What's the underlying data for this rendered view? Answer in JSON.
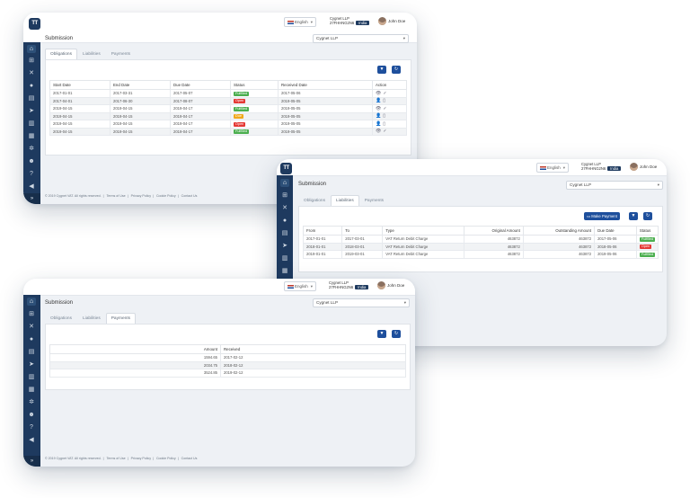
{
  "common": {
    "logo": "TT",
    "language": "English",
    "company_name": "Cygnet LLP",
    "company_vat": "27FHHNG2N6",
    "country_badge": "India",
    "user_name": "John Doe",
    "page_title": "Submission",
    "company_select": "Cygnet LLP",
    "tabs": [
      "Obligations",
      "Liabilities",
      "Payments"
    ],
    "footer": {
      "copyright": "© 2019 Cygnet VAT. All rights reserved.",
      "links": [
        "Terms of Use",
        "Privacy Policy",
        "Cookie Policy",
        "Contact Us"
      ]
    },
    "colors": {
      "sidebar": "#1e3a5f",
      "primary": "#1e4f9c",
      "fulfilled": "#4caf50",
      "open": "#e53935",
      "due": "#f0a81c"
    }
  },
  "obligations": {
    "columns": [
      "Start Date",
      "End Date",
      "Due Date",
      "Status",
      "Received Date",
      "Action"
    ],
    "rows": [
      {
        "start": "2017-01-01",
        "end": "2017-03-31",
        "due": "2017-05-07",
        "status": "Fulfilled",
        "received": "2017-05-06",
        "action": "view,check"
      },
      {
        "start": "2017-04-01",
        "end": "2017-06-30",
        "due": "2017-08-07",
        "status": "Open",
        "received": "2019-05-05",
        "action": "user,doc"
      },
      {
        "start": "2019-04-15",
        "end": "2019-04-15",
        "due": "2019-04-17",
        "status": "Fulfilled",
        "received": "2019-05-05",
        "action": "view,check"
      },
      {
        "start": "2019-04-15",
        "end": "2019-04-15",
        "due": "2019-04-17",
        "status": "Due",
        "received": "2019-05-05",
        "action": "user,doc"
      },
      {
        "start": "2019-04-15",
        "end": "2019-04-15",
        "due": "2019-04-17",
        "status": "Open",
        "received": "2019-05-05",
        "action": "user,doc"
      },
      {
        "start": "2019-04-15",
        "end": "2019-04-15",
        "due": "2019-04-17",
        "status": "Fulfilled",
        "received": "2019-05-05",
        "action": "view,check"
      }
    ]
  },
  "liabilities": {
    "make_payment": "Make Payment",
    "columns": [
      "From",
      "To",
      "Type",
      "Original Amount",
      "Outstanding Amount",
      "Due Date",
      "Status"
    ],
    "rows": [
      {
        "from": "2017-01-01",
        "to": "2017-03-01",
        "type": "VAT Return Debit Charge",
        "original": "463872",
        "outstanding": "463872",
        "due": "2017-05-06",
        "status": "Fulfilled"
      },
      {
        "from": "2018-01-01",
        "to": "2018-03-01",
        "type": "VAT Return Debit Charge",
        "original": "463872",
        "outstanding": "463872",
        "due": "2018-05-06",
        "status": "Open"
      },
      {
        "from": "2019-01-01",
        "to": "2019-03-01",
        "type": "VAT Return Debit Charge",
        "original": "463872",
        "outstanding": "463872",
        "due": "2019-05-06",
        "status": "Fulfilled"
      }
    ]
  },
  "payments": {
    "columns": [
      "Amount",
      "Received"
    ],
    "rows": [
      {
        "amount": "1594.65",
        "received": "2017-02-12"
      },
      {
        "amount": "2034.75",
        "received": "2018-02-12"
      },
      {
        "amount": "3524.85",
        "received": "2019-02-12"
      }
    ]
  }
}
